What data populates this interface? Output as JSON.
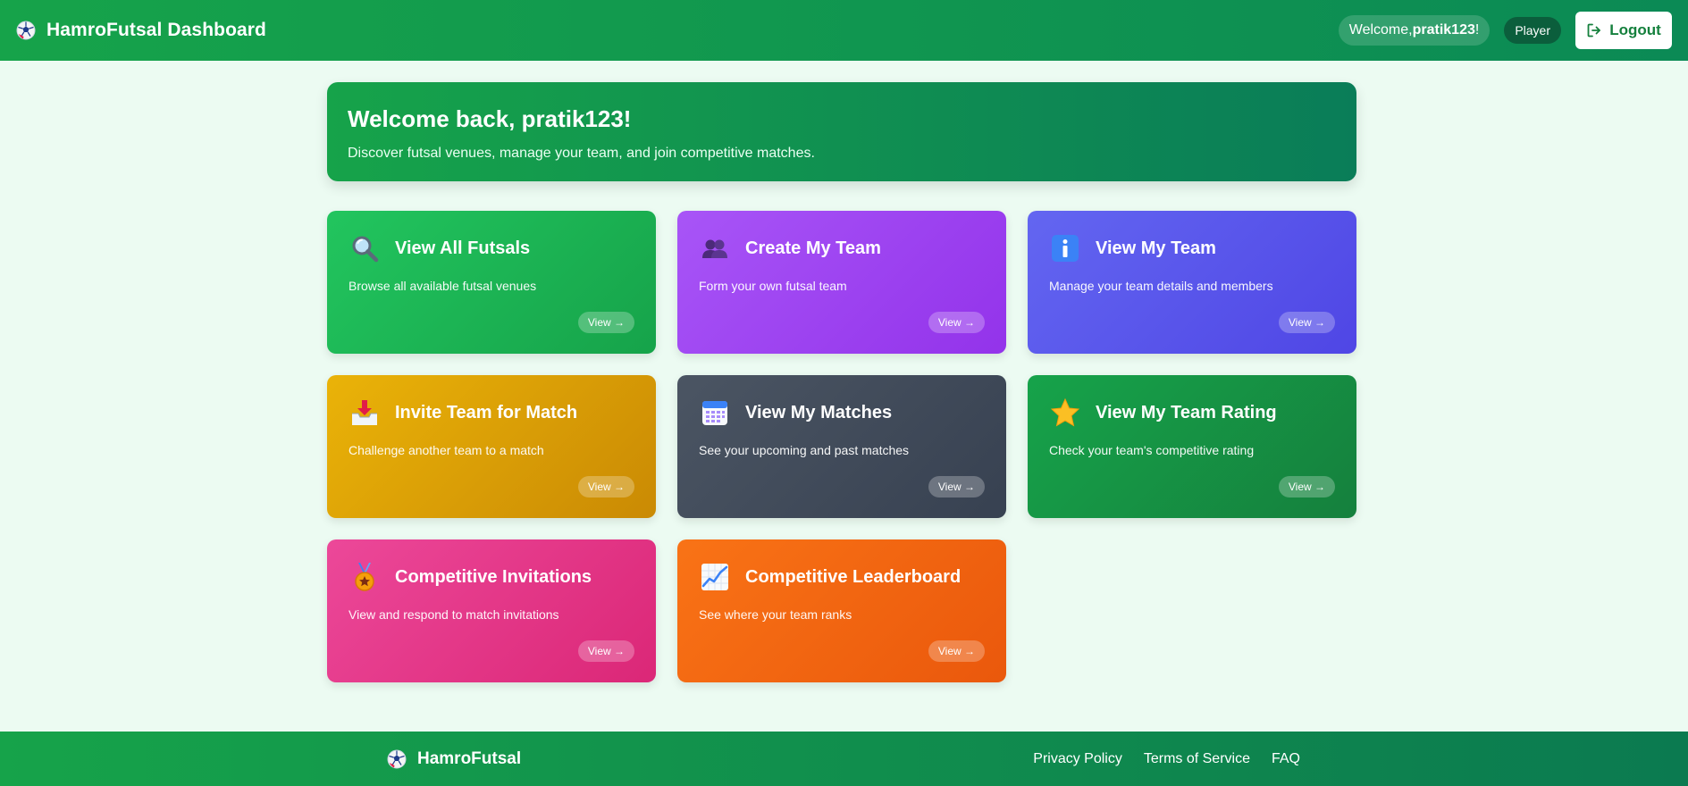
{
  "header": {
    "title": "HamroFutsal Dashboard",
    "welcome_prefix": "Welcome, ",
    "username": "pratik123",
    "welcome_suffix": "!",
    "role": "Player",
    "logout_label": "Logout"
  },
  "hero": {
    "title": "Welcome back, pratik123!",
    "subtitle": "Discover futsal venues, manage your team, and join competitive matches."
  },
  "cards": [
    {
      "title": "View All Futsals",
      "description": "Browse all available futsal venues",
      "button": "View →",
      "icon": "magnifier-icon"
    },
    {
      "title": "Create My Team",
      "description": "Form your own futsal team",
      "button": "View →",
      "icon": "people-icon"
    },
    {
      "title": "View My Team",
      "description": "Manage your team details and members",
      "button": "View →",
      "icon": "info-icon"
    },
    {
      "title": "Invite Team for Match",
      "description": "Challenge another team to a match",
      "button": "View →",
      "icon": "inbox-tray-icon"
    },
    {
      "title": "View My Matches",
      "description": "See your upcoming and past matches",
      "button": "View →",
      "icon": "calendar-icon"
    },
    {
      "title": "View My Team Rating",
      "description": "Check your team's competitive rating",
      "button": "View →",
      "icon": "star-icon"
    },
    {
      "title": "Competitive Invitations",
      "description": "View and respond to match invitations",
      "button": "View →",
      "icon": "medal-icon"
    },
    {
      "title": "Competitive Leaderboard",
      "description": "See where your team ranks",
      "button": "View →",
      "icon": "chart-up-icon"
    }
  ],
  "footer": {
    "brand": "HamroFutsal",
    "links": [
      "Privacy Policy",
      "Terms of Service",
      "FAQ"
    ]
  }
}
